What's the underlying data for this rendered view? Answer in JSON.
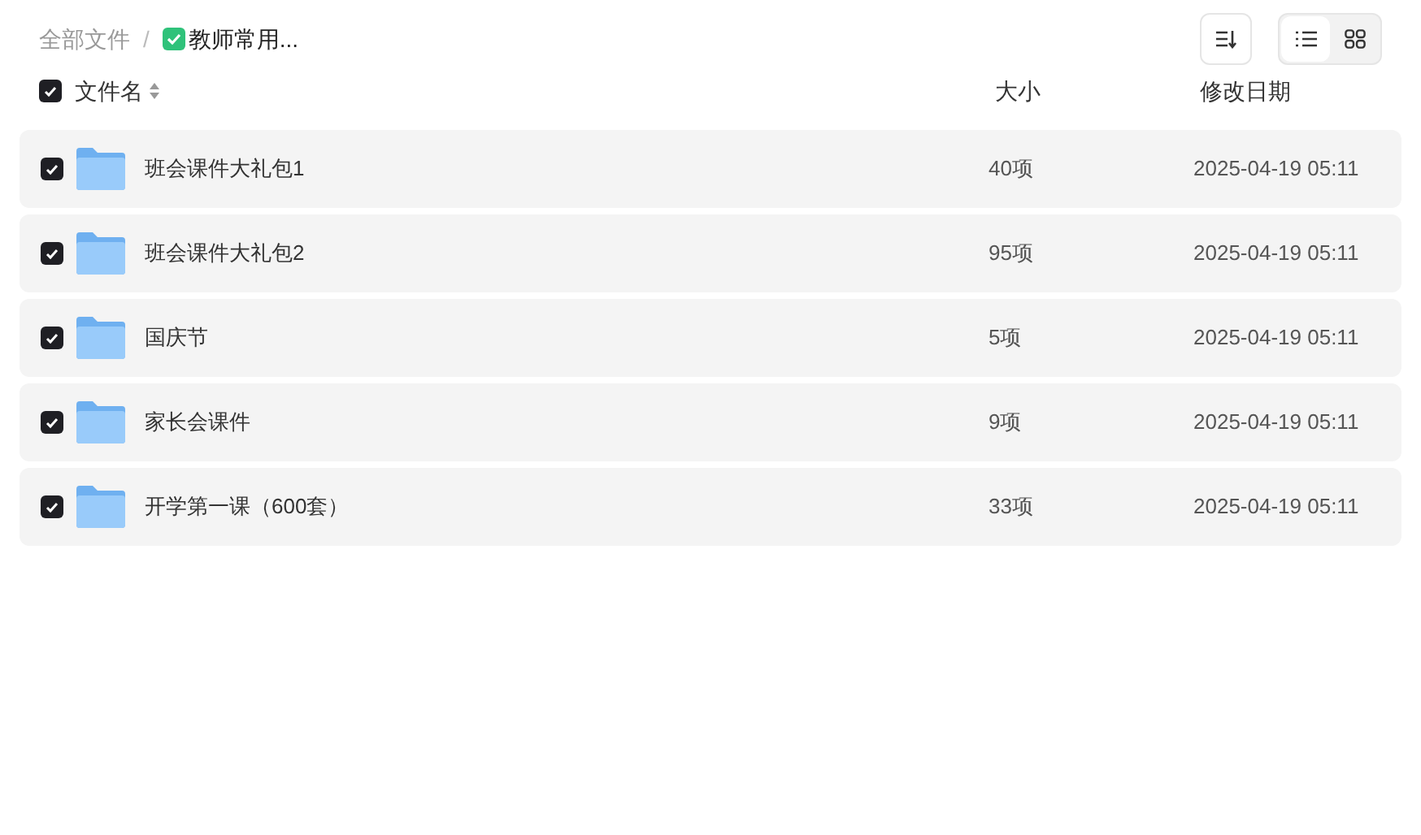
{
  "breadcrumb": [
    {
      "label": "全部文件",
      "current": false
    },
    {
      "separator": "/",
      "label": "教师常用...",
      "current": true
    }
  ],
  "view_toggle": [
    {
      "kind": "list",
      "selected": true
    },
    {
      "kind": "grid",
      "selected": false
    }
  ],
  "header": {
    "checked": true,
    "columns": [
      "文件名",
      "大小",
      "修改日期"
    ]
  },
  "rows": [
    {
      "name": "班会课件大礼包1",
      "size": "40项",
      "date": "2025-04-19 05:11",
      "checked": true
    },
    {
      "name": "班会课件大礼包2",
      "size": "95项",
      "date": "2025-04-19 05:11",
      "checked": true
    },
    {
      "name": "国庆节",
      "size": "5项",
      "date": "2025-04-19 05:11",
      "checked": true
    },
    {
      "name": "家长会课件",
      "size": "9项",
      "date": "2025-04-19 05:11",
      "checked": true
    },
    {
      "name": "开学第一课（600套）",
      "size": "33项",
      "date": "2025-04-19 05:11",
      "checked": true
    }
  ]
}
